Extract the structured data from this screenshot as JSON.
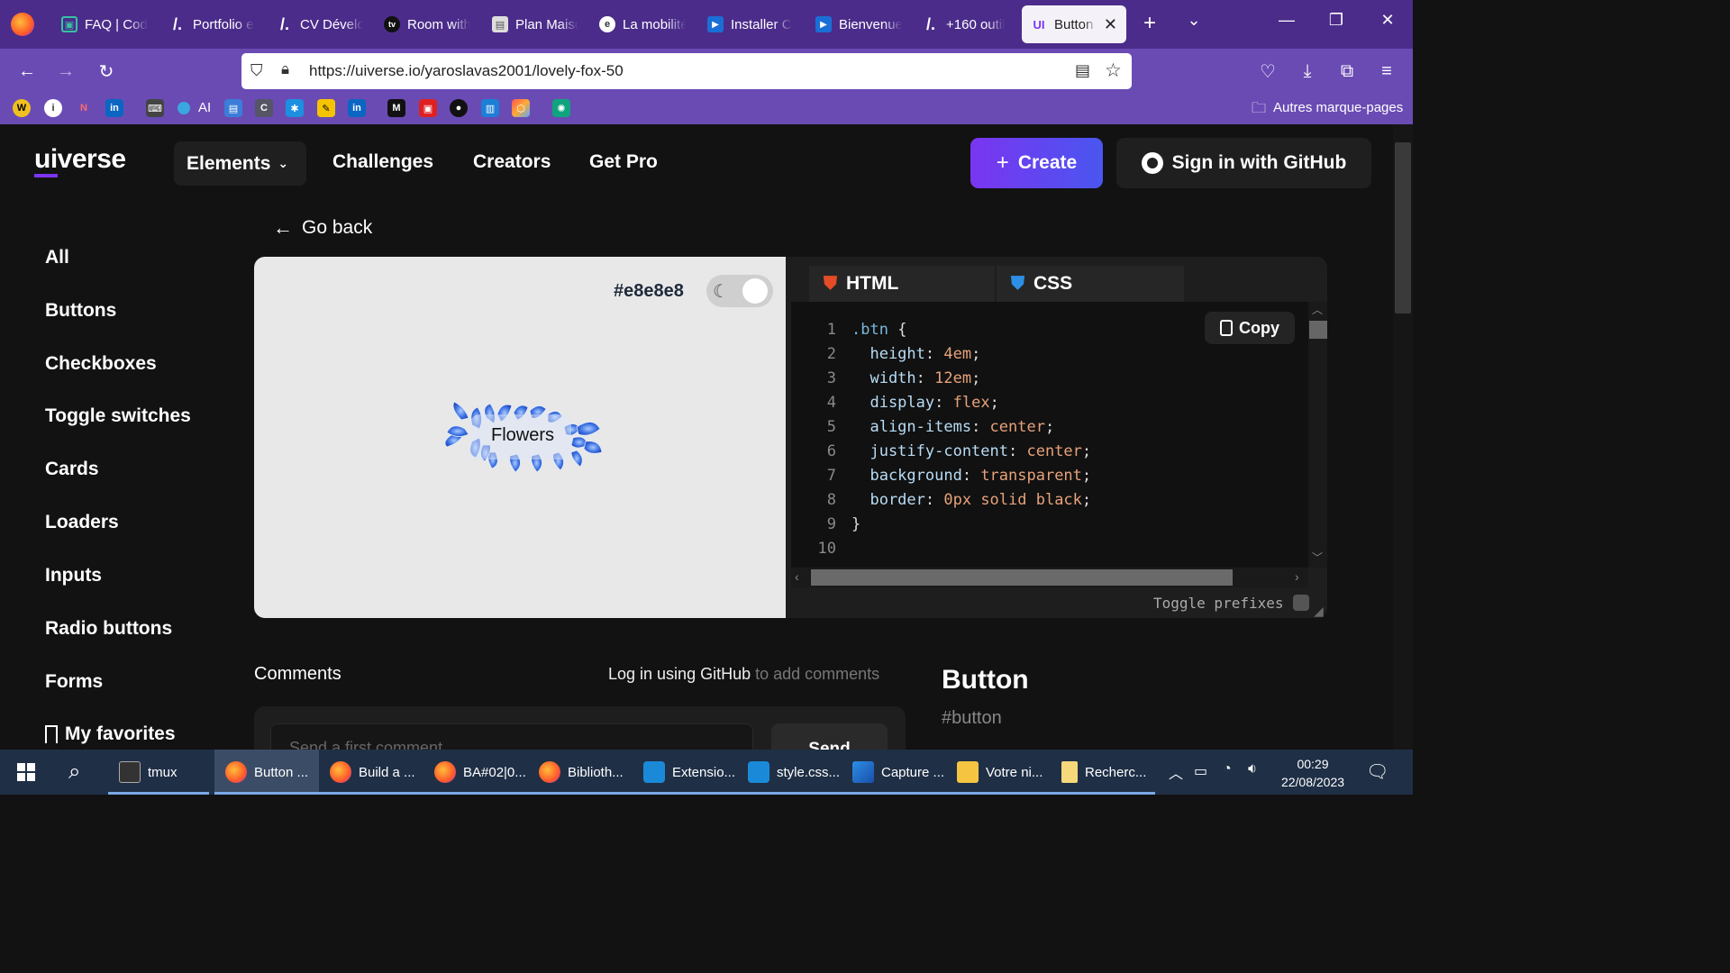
{
  "browser": {
    "tabs": [
      {
        "title": "FAQ | Cod",
        "icon": "codepen-icon"
      },
      {
        "title": "Portfolio e",
        "icon": "slash-icon"
      },
      {
        "title": "CV Dévelo",
        "icon": "slash-icon"
      },
      {
        "title": "Room with",
        "icon": "tv-icon"
      },
      {
        "title": "Plan Maiso",
        "icon": "doc-icon"
      },
      {
        "title": "La mobilité",
        "icon": "e-icon"
      },
      {
        "title": "Installer C",
        "icon": "play-icon"
      },
      {
        "title": "Bienvenue",
        "icon": "play-icon"
      },
      {
        "title": "+160 outil",
        "icon": "slash-icon"
      },
      {
        "title": "Button",
        "icon": "uiverse-icon",
        "active": true
      }
    ],
    "url": "https://uiverse.io/yaroslavas2001/lovely-fox-50",
    "bookmarks_other": "Autres marque-pages",
    "bookmark_ai": "AI"
  },
  "site": {
    "logo_left": "ui",
    "logo_right": "verse",
    "nav": {
      "elements": "Elements",
      "challenges": "Challenges",
      "creators": "Creators",
      "get_pro": "Get Pro"
    },
    "create": "Create",
    "github_sign_in": "Sign in with GitHub",
    "go_back": "Go back",
    "sidebar": [
      "All",
      "Buttons",
      "Checkboxes",
      "Toggle switches",
      "Cards",
      "Loaders",
      "Inputs",
      "Radio buttons",
      "Forms"
    ],
    "favorites": "My favorites"
  },
  "preview": {
    "bg_color": "#e8e8e8",
    "button_label": "Flowers"
  },
  "code": {
    "tabs": {
      "html": "HTML",
      "css": "CSS"
    },
    "copy": "Copy",
    "line_numbers": [
      "1",
      "2",
      "3",
      "4",
      "5",
      "6",
      "7",
      "8",
      "9",
      "10"
    ],
    "lines": [
      {
        "sel": ".btn",
        "punct": " {"
      },
      {
        "prop": "  height",
        "val": "4em"
      },
      {
        "prop": "  width",
        "val": "12em"
      },
      {
        "prop": "  display",
        "val": "flex"
      },
      {
        "prop": "  align-items",
        "val": "center"
      },
      {
        "prop": "  justify-content",
        "val": "center"
      },
      {
        "prop": "  background",
        "val": "transparent"
      },
      {
        "prop": "  border",
        "val": "0px solid black"
      },
      {
        "sel": "",
        "punct": "}"
      }
    ],
    "toggle_prefixes": "Toggle prefixes"
  },
  "comments": {
    "title": "Comments",
    "login_link": "Log in using GitHub",
    "login_rest": " to add comments",
    "placeholder": "Send a first comment",
    "send": "Send"
  },
  "element_info": {
    "title": "Button",
    "tag": "#button"
  },
  "taskbar": {
    "items": [
      {
        "label": "tmux"
      },
      {
        "label": "Button ..."
      },
      {
        "label": "Build a ..."
      },
      {
        "label": "BA#02|0..."
      },
      {
        "label": "Biblioth..."
      },
      {
        "label": "Extensio..."
      },
      {
        "label": "style.css..."
      },
      {
        "label": "Capture ..."
      },
      {
        "label": "Votre ni..."
      },
      {
        "label": "Recherc..."
      }
    ],
    "time": "00:29",
    "date": "22/08/2023"
  }
}
